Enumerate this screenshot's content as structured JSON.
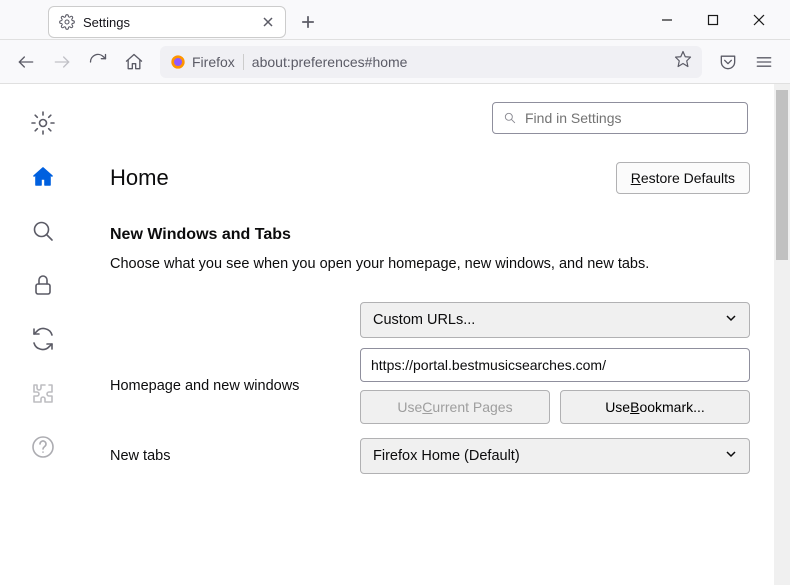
{
  "window": {
    "tab_title": "Settings"
  },
  "urlbar": {
    "app_name": "Firefox",
    "url": "about:preferences#home"
  },
  "search": {
    "placeholder": "Find in Settings"
  },
  "page": {
    "title": "Home",
    "restore_defaults": "Restore Defaults",
    "section_title": "New Windows and Tabs",
    "section_desc": "Choose what you see when you open your homepage, new windows, and new tabs."
  },
  "form": {
    "homepage_label": "Homepage and new windows",
    "homepage_select": "Custom URLs...",
    "homepage_value": "https://portal.bestmusicsearches.com/",
    "use_current": "Use Current Pages",
    "use_bookmark": "Use Bookmark...",
    "newtabs_label": "New tabs",
    "newtabs_select": "Firefox Home (Default)"
  }
}
